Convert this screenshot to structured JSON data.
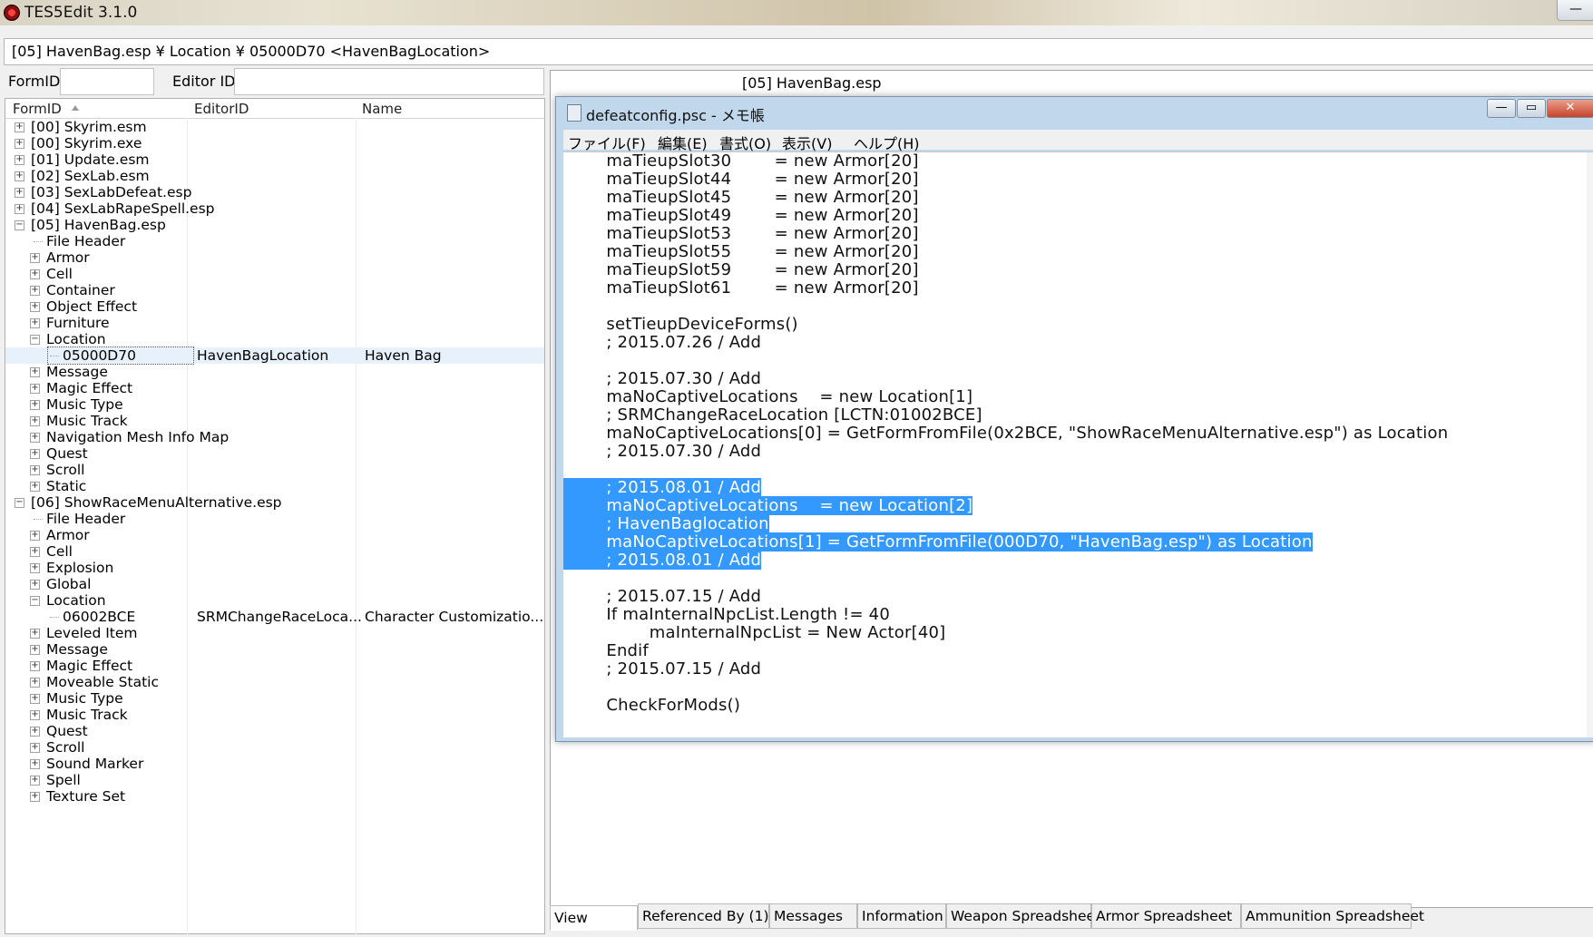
{
  "app": {
    "title": "TES5Edit 3.1.0",
    "minimize": "—"
  },
  "path": "[05] HavenBag.esp ¥ Location ¥ 05000D70 <HavenBagLocation>",
  "filter": {
    "formid_label": "FormID",
    "editorid_label": "Editor ID",
    "formid_value": "",
    "editorid_value": ""
  },
  "tree": {
    "headers": {
      "formid": "FormID",
      "editorid": "EditorID",
      "name": "Name"
    },
    "rows": [
      {
        "level": 0,
        "exp": "+",
        "text": "[00] Skyrim.esm",
        "c2": "",
        "c3": ""
      },
      {
        "level": 0,
        "exp": "+",
        "text": "[00] Skyrim.exe",
        "c2": "",
        "c3": ""
      },
      {
        "level": 0,
        "exp": "+",
        "text": "[01] Update.esm",
        "c2": "",
        "c3": ""
      },
      {
        "level": 0,
        "exp": "+",
        "text": "[02] SexLab.esm",
        "c2": "",
        "c3": ""
      },
      {
        "level": 0,
        "exp": "+",
        "text": "[03] SexLabDefeat.esp",
        "c2": "",
        "c3": ""
      },
      {
        "level": 0,
        "exp": "+",
        "text": "[04] SexLabRapeSpell.esp",
        "c2": "",
        "c3": ""
      },
      {
        "level": 0,
        "exp": "-",
        "text": "[05] HavenBag.esp",
        "c2": "",
        "c3": ""
      },
      {
        "level": 1,
        "exp": "",
        "text": "File Header",
        "c2": "",
        "c3": ""
      },
      {
        "level": 1,
        "exp": "+",
        "text": "Armor",
        "c2": "",
        "c3": ""
      },
      {
        "level": 1,
        "exp": "+",
        "text": "Cell",
        "c2": "",
        "c3": ""
      },
      {
        "level": 1,
        "exp": "+",
        "text": "Container",
        "c2": "",
        "c3": ""
      },
      {
        "level": 1,
        "exp": "+",
        "text": "Object Effect",
        "c2": "",
        "c3": ""
      },
      {
        "level": 1,
        "exp": "+",
        "text": "Furniture",
        "c2": "",
        "c3": ""
      },
      {
        "level": 1,
        "exp": "-",
        "text": "Location",
        "c2": "",
        "c3": ""
      },
      {
        "level": 2,
        "exp": "",
        "text": "05000D70",
        "c2": "HavenBagLocation",
        "c3": "Haven Bag",
        "selected": true
      },
      {
        "level": 1,
        "exp": "+",
        "text": "Message",
        "c2": "",
        "c3": ""
      },
      {
        "level": 1,
        "exp": "+",
        "text": "Magic Effect",
        "c2": "",
        "c3": ""
      },
      {
        "level": 1,
        "exp": "+",
        "text": "Music Type",
        "c2": "",
        "c3": ""
      },
      {
        "level": 1,
        "exp": "+",
        "text": "Music Track",
        "c2": "",
        "c3": ""
      },
      {
        "level": 1,
        "exp": "+",
        "text": "Navigation Mesh Info Map",
        "c2": "",
        "c3": ""
      },
      {
        "level": 1,
        "exp": "+",
        "text": "Quest",
        "c2": "",
        "c3": ""
      },
      {
        "level": 1,
        "exp": "+",
        "text": "Scroll",
        "c2": "",
        "c3": ""
      },
      {
        "level": 1,
        "exp": "+",
        "text": "Static",
        "c2": "",
        "c3": ""
      },
      {
        "level": 0,
        "exp": "-",
        "text": "[06] ShowRaceMenuAlternative.esp",
        "c2": "",
        "c3": ""
      },
      {
        "level": 1,
        "exp": "",
        "text": "File Header",
        "c2": "",
        "c3": ""
      },
      {
        "level": 1,
        "exp": "+",
        "text": "Armor",
        "c2": "",
        "c3": ""
      },
      {
        "level": 1,
        "exp": "+",
        "text": "Cell",
        "c2": "",
        "c3": ""
      },
      {
        "level": 1,
        "exp": "+",
        "text": "Explosion",
        "c2": "",
        "c3": ""
      },
      {
        "level": 1,
        "exp": "+",
        "text": "Global",
        "c2": "",
        "c3": ""
      },
      {
        "level": 1,
        "exp": "-",
        "text": "Location",
        "c2": "",
        "c3": ""
      },
      {
        "level": 2,
        "exp": "",
        "text": "06002BCE",
        "c2": "SRMChangeRaceLoca...",
        "c3": "Character Customizatio..."
      },
      {
        "level": 1,
        "exp": "+",
        "text": "Leveled Item",
        "c2": "",
        "c3": ""
      },
      {
        "level": 1,
        "exp": "+",
        "text": "Message",
        "c2": "",
        "c3": ""
      },
      {
        "level": 1,
        "exp": "+",
        "text": "Magic Effect",
        "c2": "",
        "c3": ""
      },
      {
        "level": 1,
        "exp": "+",
        "text": "Moveable Static",
        "c2": "",
        "c3": ""
      },
      {
        "level": 1,
        "exp": "+",
        "text": "Music Type",
        "c2": "",
        "c3": ""
      },
      {
        "level": 1,
        "exp": "+",
        "text": "Music Track",
        "c2": "",
        "c3": ""
      },
      {
        "level": 1,
        "exp": "+",
        "text": "Quest",
        "c2": "",
        "c3": ""
      },
      {
        "level": 1,
        "exp": "+",
        "text": "Scroll",
        "c2": "",
        "c3": ""
      },
      {
        "level": 1,
        "exp": "+",
        "text": "Sound Marker",
        "c2": "",
        "c3": ""
      },
      {
        "level": 1,
        "exp": "+",
        "text": "Spell",
        "c2": "",
        "c3": ""
      },
      {
        "level": 1,
        "exp": "+",
        "text": "Texture Set",
        "c2": "",
        "c3": ""
      }
    ]
  },
  "right": {
    "title": "[05] HavenBag.esp",
    "tabs": [
      "View",
      "Referenced By (1)",
      "Messages",
      "Information",
      "Weapon Spreadsheet",
      "Armor Spreadsheet",
      "Ammunition Spreadsheet"
    ],
    "active_tab": "View"
  },
  "notepad": {
    "title": "defeatconfig.psc - メモ帳",
    "menu": [
      "ファイル(F)",
      "編集(E)",
      "書式(O)",
      "表示(V)",
      "ヘルプ(H)"
    ],
    "lines": [
      {
        "text": "        maTieupSlot30        = new Armor[20]",
        "sel": false
      },
      {
        "text": "        maTieupSlot44        = new Armor[20]",
        "sel": false
      },
      {
        "text": "        maTieupSlot45        = new Armor[20]",
        "sel": false
      },
      {
        "text": "        maTieupSlot49        = new Armor[20]",
        "sel": false
      },
      {
        "text": "        maTieupSlot53        = new Armor[20]",
        "sel": false
      },
      {
        "text": "        maTieupSlot55        = new Armor[20]",
        "sel": false
      },
      {
        "text": "        maTieupSlot59        = new Armor[20]",
        "sel": false
      },
      {
        "text": "        maTieupSlot61        = new Armor[20]",
        "sel": false
      },
      {
        "text": "",
        "sel": false
      },
      {
        "text": "        setTieupDeviceForms()",
        "sel": false
      },
      {
        "text": "        ; 2015.07.26 / Add",
        "sel": false
      },
      {
        "text": "",
        "sel": false
      },
      {
        "text": "        ; 2015.07.30 / Add",
        "sel": false
      },
      {
        "text": "        maNoCaptiveLocations    = new Location[1]",
        "sel": false
      },
      {
        "text": "        ; SRMChangeRaceLocation [LCTN:01002BCE]",
        "sel": false
      },
      {
        "text": "        maNoCaptiveLocations[0] = GetFormFromFile(0x2BCE, \"ShowRaceMenuAlternative.esp\") as Location",
        "sel": false
      },
      {
        "text": "        ; 2015.07.30 / Add",
        "sel": false
      },
      {
        "text": "",
        "sel": false
      },
      {
        "text": "        ; 2015.08.01 / Add",
        "sel": true
      },
      {
        "text": "        maNoCaptiveLocations    = new Location[2]",
        "sel": true
      },
      {
        "text": "        ; HavenBaglocation",
        "sel": true
      },
      {
        "text": "        maNoCaptiveLocations[1] = GetFormFromFile(000D70, \"HavenBag.esp\") as Location",
        "sel": true
      },
      {
        "text": "        ; 2015.08.01 / Add",
        "sel": true
      },
      {
        "text": "",
        "sel": false
      },
      {
        "text": "        ; 2015.07.15 / Add",
        "sel": false
      },
      {
        "text": "        If maInternalNpcList.Length != 40",
        "sel": false
      },
      {
        "text": "                maInternalNpcList = New Actor[40]",
        "sel": false
      },
      {
        "text": "        Endif",
        "sel": false
      },
      {
        "text": "        ; 2015.07.15 / Add",
        "sel": false
      },
      {
        "text": "",
        "sel": false
      },
      {
        "text": "        CheckForMods()",
        "sel": false
      }
    ]
  },
  "colors": {
    "selection": "#3399ff",
    "tree_selected": "#e7f1fb"
  }
}
